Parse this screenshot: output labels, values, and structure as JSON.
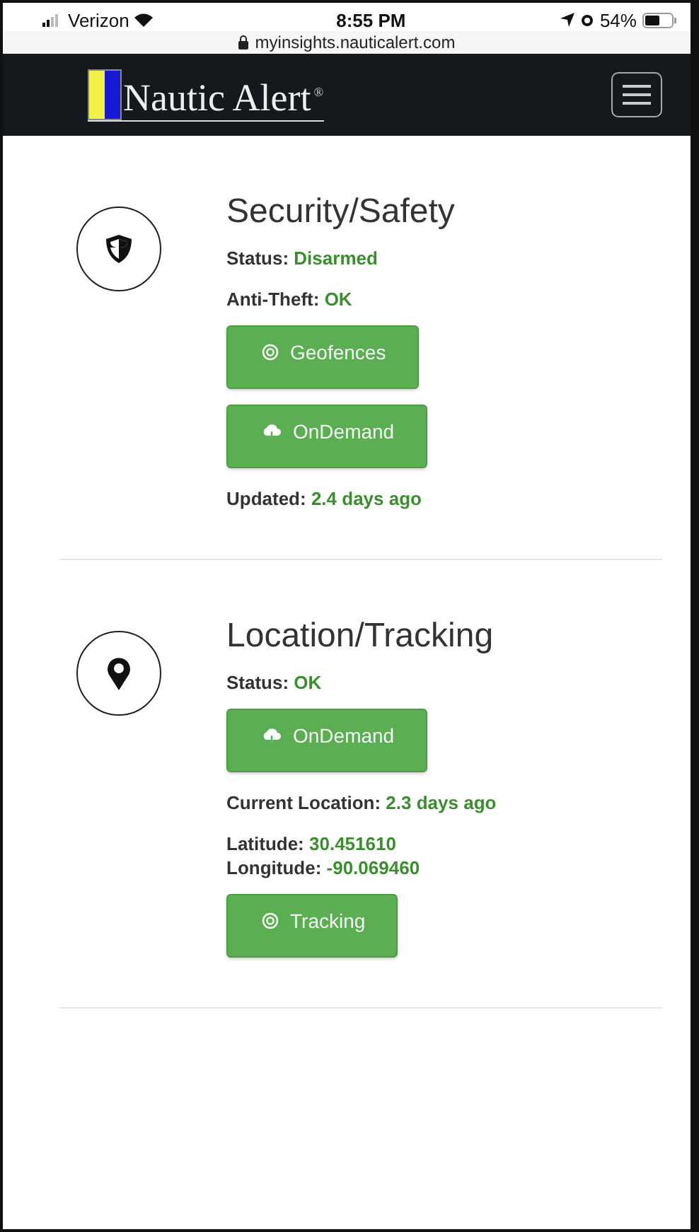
{
  "status_bar": {
    "carrier": "Verizon",
    "time": "8:55 PM",
    "battery": "54%"
  },
  "address_bar": {
    "url": "myinsights.nauticalert.com"
  },
  "header": {
    "brand_initial": "N",
    "brand_rest": "autic Alert",
    "trademark": "®"
  },
  "sections": [
    {
      "title": "Security/Safety",
      "kind": "security",
      "items": [
        {
          "kind": "fields",
          "lines": [
            {
              "label": "Status:",
              "value": "Disarmed"
            }
          ]
        },
        {
          "kind": "fields",
          "lines": [
            {
              "label": "Anti-Theft:",
              "value": "OK"
            }
          ]
        },
        {
          "kind": "target-button",
          "label": "Geofences"
        },
        {
          "kind": "cloud-button",
          "label": "OnDemand"
        },
        {
          "kind": "fields",
          "lines": [
            {
              "label": "Updated:",
              "value": "2.4 days ago"
            }
          ]
        }
      ]
    },
    {
      "title": "Location/Tracking",
      "kind": "location",
      "items": [
        {
          "kind": "fields",
          "lines": [
            {
              "label": "Status:",
              "value": "OK"
            }
          ]
        },
        {
          "kind": "cloud-button",
          "label": "OnDemand"
        },
        {
          "kind": "fields",
          "lines": [
            {
              "label": "Current Location:",
              "value": "2.3 days ago"
            }
          ]
        },
        {
          "kind": "fields",
          "lines": [
            {
              "label": "Latitude:",
              "value": "30.451610"
            },
            {
              "label": "Longitude:",
              "value": "-90.069460"
            }
          ]
        },
        {
          "kind": "target-button",
          "label": "Tracking"
        }
      ]
    }
  ]
}
